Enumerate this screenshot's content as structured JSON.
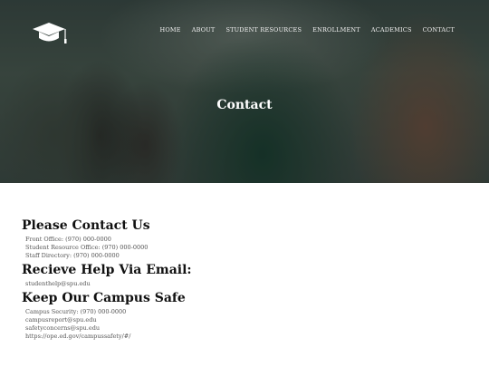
{
  "nav": {
    "items": [
      "HOME",
      "ABOUT",
      "STUDENT RESOURCES",
      "ENROLLMENT",
      "ACADEMICS",
      "CONTACT"
    ]
  },
  "hero": {
    "title": "Contact"
  },
  "sections": [
    {
      "heading": "Please Contact Us",
      "lines": [
        "Front Office: (970) 000-0000",
        "Student Resource Office: (970) 000-0000",
        "Staff Directory: (970) 000-0000"
      ]
    },
    {
      "heading": "Recieve Help Via Email:",
      "lines": [
        "studenthelp@spu.edu"
      ]
    },
    {
      "heading": "Keep Our Campus Safe",
      "lines": [
        "Campus Security: (970) 000-0000",
        "campusreport@spu.edu",
        "safetyconcerns@spu.edu",
        "https://ope.ed.gov/campussafety/#/"
      ]
    }
  ],
  "logo_icon": "graduation-cap-icon"
}
